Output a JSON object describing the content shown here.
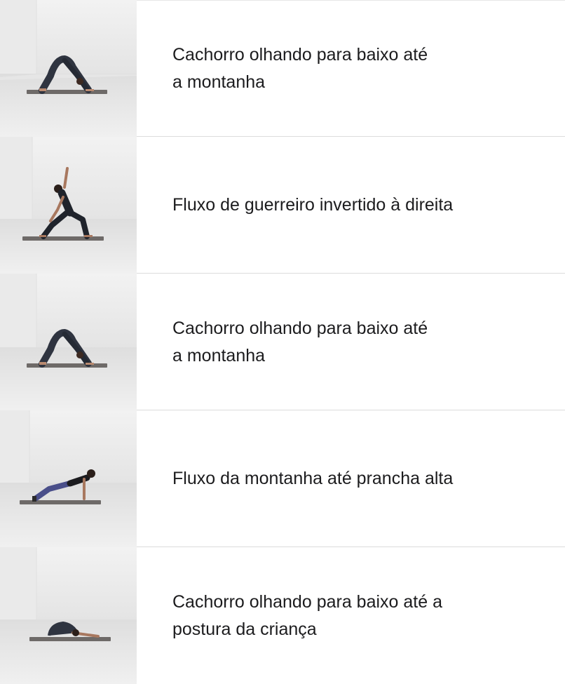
{
  "workout_list": {
    "items": [
      {
        "title": "Cachorro olhando para baixo até\na montanha",
        "thumbnail_icon": "downward-dog-pose-icon"
      },
      {
        "title": "Fluxo de guerreiro invertido à direita",
        "thumbnail_icon": "reverse-warrior-pose-icon"
      },
      {
        "title": "Cachorro olhando para baixo até\na montanha",
        "thumbnail_icon": "downward-dog-pose-icon"
      },
      {
        "title": "Fluxo da montanha até prancha alta",
        "thumbnail_icon": "high-plank-pose-icon"
      },
      {
        "title": "Cachorro olhando para baixo até a\npostura da criança",
        "thumbnail_icon": "child-pose-icon"
      }
    ]
  },
  "colors": {
    "background": "#ffffff",
    "thumbnail_background": "#ececec",
    "text": "#1c1c1e",
    "divider": "#dcdcdc",
    "mat": "#6e6a68"
  }
}
